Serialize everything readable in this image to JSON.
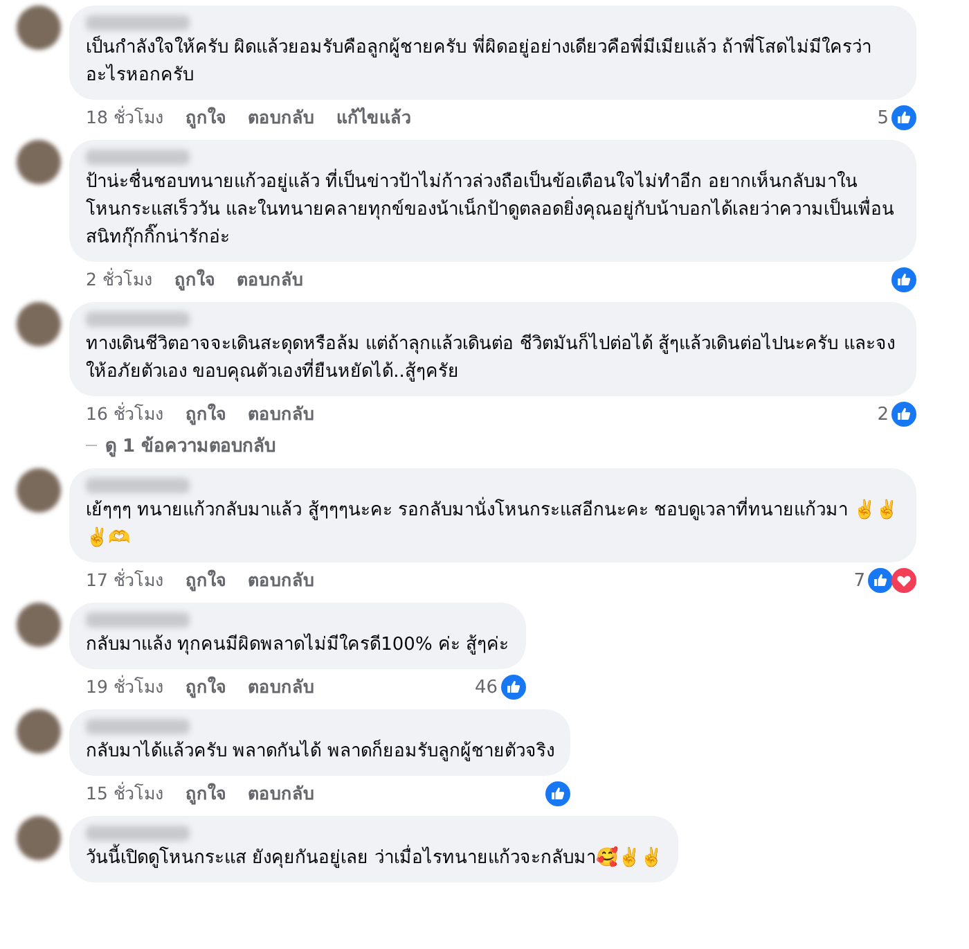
{
  "comments": [
    {
      "text": "เป็นกำลังใจให้ครับ ผิดแล้วยอมรับคือลูกผู้ชายครับ พี่ผิดอยู่อย่างเดียวคือพี่มีเมียแล้ว ถ้าพี่โสดไม่มีใครว่าอะไรหอกครับ",
      "time": "18 ชั่วโมง",
      "actions": [
        "ถูกใจ",
        "ตอบกลับ",
        "แก้ไขแล้ว"
      ],
      "reaction_count": "5",
      "reactions": [
        {
          "kind": "like"
        }
      ]
    },
    {
      "text": "ป้าน่ะชื่นชอบทนายแก้วอยู่แล้ว ที่เป็นข่าวป้าไม่ก้าวล่วงถือเป็นข้อเตือนใจไม่ทำอีก อยากเห็นกลับมาในโหนกระแสเร็ววัน และในทนายคลายทุกข์ของน้าเน็กป้าดูตลอดยิ่งคุณอยู่กับน้าบอกได้เลยว่าความเป็นเพื่อนสนิทกุ๊กกิ๊กน่ารักอ่ะ",
      "time": "2 ชั่วโมง",
      "actions": [
        "ถูกใจ",
        "ตอบกลับ"
      ],
      "reactions": [
        {
          "kind": "like"
        }
      ]
    },
    {
      "text": "ทางเดินชีวิตอาจจะเดินสะดุดหรือล้ม แต่ถ้าลุกแล้วเดินต่อ ชีวิตมันก็ไปต่อได้ สู้ๆแล้วเดินต่อไปนะครับ และจงให้อภัยตัวเอง ขอบคุณตัวเองที่ยืนหยัดได้..สู้ๆครัย",
      "time": "16 ชั่วโมง",
      "actions": [
        "ถูกใจ",
        "ตอบกลับ"
      ],
      "reaction_count": "2",
      "reactions": [
        {
          "kind": "like"
        }
      ],
      "replies_link": "ดู 1 ข้อความตอบกลับ"
    },
    {
      "text": "เย้ๆๆๆ ทนายแก้วกลับมาแล้ว สู้ๆๆๆนะคะ รอกลับมานั่งโหนกระแสอีกนะคะ ชอบดูเวลาที่ทนายแก้วมา ✌️✌️✌️🫶",
      "time": "17 ชั่วโมง",
      "actions": [
        "ถูกใจ",
        "ตอบกลับ"
      ],
      "reaction_count": "7",
      "reactions": [
        {
          "kind": "like"
        },
        {
          "kind": "love"
        }
      ]
    },
    {
      "text": "กลับมาแล้ง ทุกคนมีผิดพลาดไม่มีใครดี100% ค่ะ สู้ๆค่ะ",
      "time": "19 ชั่วโมง",
      "actions": [
        "ถูกใจ",
        "ตอบกลับ"
      ],
      "reaction_count": "46",
      "reactions": [
        {
          "kind": "like"
        }
      ]
    },
    {
      "text": "กลับมาได้แล้วครับ พลาดกันได้ พลาดก็ยอมรับลูกผู้ชายตัวจริง",
      "time": "15 ชั่วโมง",
      "actions": [
        "ถูกใจ",
        "ตอบกลับ"
      ],
      "reactions": [
        {
          "kind": "like"
        }
      ]
    },
    {
      "text": "วันนี้เปิดดูโหนกระแส ยังคุยกันอยู่เลย ว่าเมื่อไรทนายแก้วจะกลับมา🥰✌️✌️"
    }
  ]
}
